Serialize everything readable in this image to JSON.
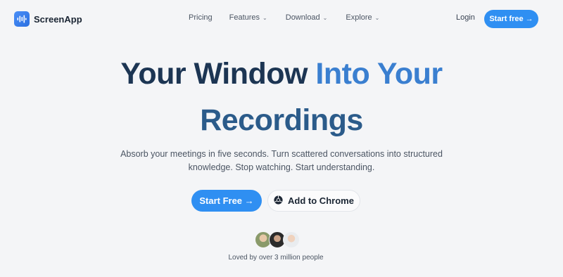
{
  "brand": {
    "name": "ScreenApp",
    "accent": "#2f8ff2"
  },
  "nav": {
    "links": [
      {
        "label": "Pricing",
        "has_dropdown": false
      },
      {
        "label": "Features",
        "has_dropdown": true
      },
      {
        "label": "Download",
        "has_dropdown": true
      },
      {
        "label": "Explore",
        "has_dropdown": true
      }
    ],
    "login_label": "Login",
    "cta_label": "Start free →"
  },
  "hero": {
    "title_line1_part1": "Your Window ",
    "title_line1_part2": "Into Your",
    "title_line2": "Recordings",
    "subtitle": "Absorb your meetings in five seconds. Turn scattered conversations into structured knowledge. Stop watching. Start understanding.",
    "primary_button": "Start Free →",
    "secondary_button": "Add to Chrome",
    "social_proof": "Loved by over 3 million people"
  },
  "icons": {
    "logo": "audio-wave-icon",
    "chrome": "chrome-icon",
    "chevron": "chevron-down-icon"
  }
}
